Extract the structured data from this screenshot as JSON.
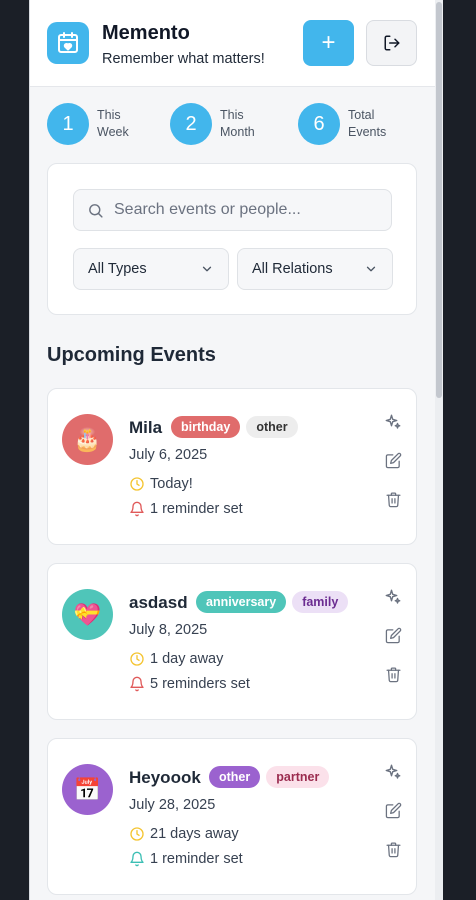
{
  "header": {
    "title": "Memento",
    "subtitle": "Remember what matters!",
    "add_label": "+",
    "logo_icon": "calendar-heart-icon",
    "logout_icon": "logout-icon"
  },
  "stats": [
    {
      "value": "1",
      "label_line1": "This",
      "label_line2": "Week"
    },
    {
      "value": "2",
      "label_line1": "This",
      "label_line2": "Month"
    },
    {
      "value": "6",
      "label_line1": "Total",
      "label_line2": "Events"
    }
  ],
  "filters": {
    "search_placeholder": "Search events or people...",
    "type_value": "All Types",
    "relation_value": "All Relations"
  },
  "section_title": "Upcoming Events",
  "events": [
    {
      "name": "Mila",
      "avatar_emoji": "🎂",
      "avatar_color": "#e06c6c",
      "tags": [
        {
          "text": "birthday",
          "bg": "#e06c6c",
          "fg": "#ffffff"
        },
        {
          "text": "other",
          "bg": "#ededed",
          "fg": "#333333"
        }
      ],
      "date": "July 6, 2025",
      "countdown": "Today!",
      "reminders": "1 reminder set",
      "bell_color": "#e05a5a"
    },
    {
      "name": "asdasd",
      "avatar_emoji": "💝",
      "avatar_color": "#4fc5b9",
      "tags": [
        {
          "text": "anniversary",
          "bg": "#4fc5b9",
          "fg": "#ffffff"
        },
        {
          "text": "family",
          "bg": "#ece0f6",
          "fg": "#6b2c91"
        }
      ],
      "date": "July 8, 2025",
      "countdown": "1 day away",
      "reminders": "5 reminders set",
      "bell_color": "#e05a5a"
    },
    {
      "name": "Heyoook",
      "avatar_emoji": "📅",
      "avatar_color": "#9b62cf",
      "tags": [
        {
          "text": "other",
          "bg": "#9b62cf",
          "fg": "#ffffff"
        },
        {
          "text": "partner",
          "bg": "#fbe1ea",
          "fg": "#9b2c4f"
        }
      ],
      "date": "July 28, 2025",
      "countdown": "21 days away",
      "reminders": "1 reminder set",
      "bell_color": "#3cbfb4"
    }
  ],
  "colors": {
    "accent": "#42b6ec",
    "clock": "#f4c430"
  }
}
